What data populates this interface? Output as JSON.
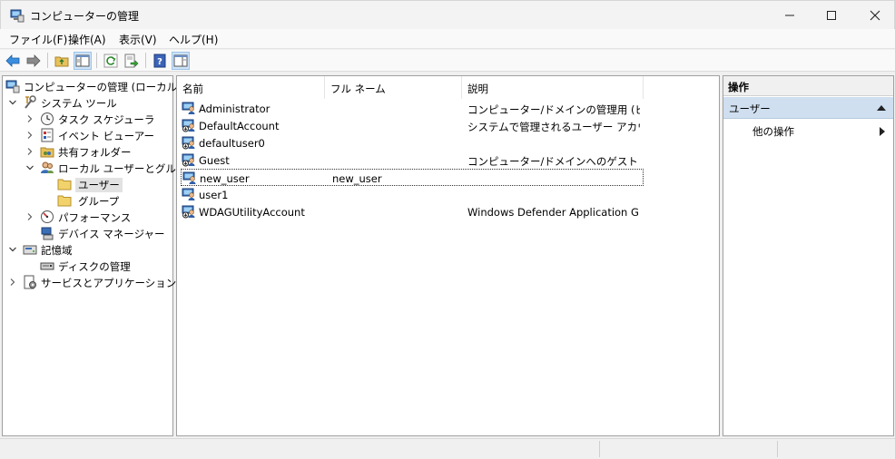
{
  "window": {
    "title": "コンピューターの管理",
    "app_icon": "computer-management-icon"
  },
  "menu": [
    "ファイル(F)",
    "操作(A)",
    "表示(V)",
    "ヘルプ(H)"
  ],
  "toolbar": {
    "buttons": [
      "back-arrow-icon",
      "forward-arrow-icon",
      "up-folder-icon",
      "show-hide-tree-icon",
      "refresh-icon",
      "export-list-icon",
      "help-icon",
      "show-hide-action-pane-icon"
    ]
  },
  "tree": {
    "root": "コンピューターの管理 (ローカル)",
    "system_tools": "システム ツール",
    "task_scheduler": "タスク スケジューラ",
    "event_viewer": "イベント ビューアー",
    "shared_folders": "共有フォルダー",
    "local_users_groups": "ローカル ユーザーとグループ",
    "users": "ユーザー",
    "groups": "グループ",
    "performance": "パフォーマンス",
    "device_manager": "デバイス マネージャー",
    "storage": "記憶域",
    "disk_management": "ディスクの管理",
    "services_apps": "サービスとアプリケーション"
  },
  "list": {
    "columns": [
      "名前",
      "フル ネーム",
      "説明"
    ],
    "rows": [
      {
        "name": "Administrator",
        "full_name": "",
        "description": "コンピューター/ドメインの管理用 (ビルト…",
        "disabled": false
      },
      {
        "name": "DefaultAccount",
        "full_name": "",
        "description": "システムで管理されるユーザー アカウン…",
        "disabled": true
      },
      {
        "name": "defaultuser0",
        "full_name": "",
        "description": "",
        "disabled": true
      },
      {
        "name": "Guest",
        "full_name": "",
        "description": "コンピューター/ドメインへのゲスト アクセ…",
        "disabled": true
      },
      {
        "name": "new_user",
        "full_name": "new_user",
        "description": "",
        "disabled": false
      },
      {
        "name": "user1",
        "full_name": "",
        "description": "",
        "disabled": false
      },
      {
        "name": "WDAGUtilityAccount",
        "full_name": "",
        "description": "Windows Defender Application G…",
        "disabled": true
      }
    ],
    "focused_row": 4
  },
  "actions": {
    "header": "操作",
    "group": "ユーザー",
    "more": "他の操作"
  },
  "colors": {
    "accent_group": "#cfdff0",
    "selection": "#e2e2e2"
  }
}
